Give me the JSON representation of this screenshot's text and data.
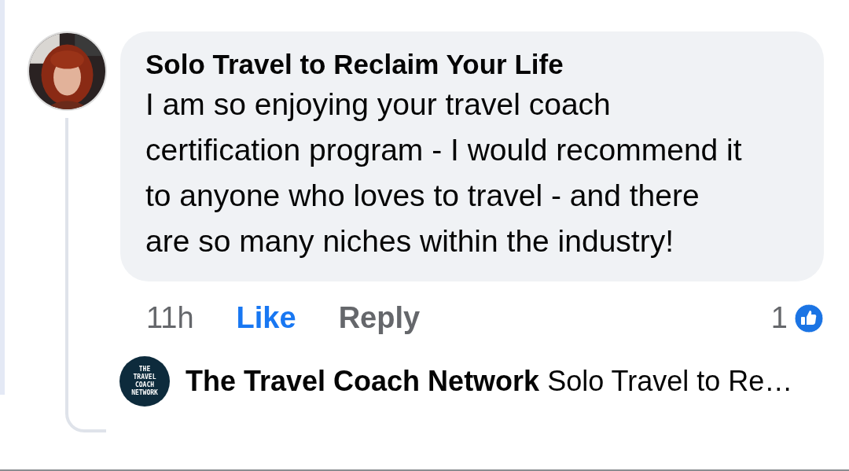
{
  "comment": {
    "author": "Solo Travel to Reclaim Your Life",
    "text": "I am so enjoying your travel coach certification program - I would recommend it to anyone who loves to travel - and there are so many niches within the industry!",
    "time": "11h",
    "actions": [
      {
        "label": "Like",
        "liked": true
      },
      {
        "label": "Reply",
        "liked": false
      }
    ],
    "reaction_count": "1"
  },
  "reply": {
    "logo_lines": [
      "THE",
      "TRAVEL",
      "COACH",
      "NETWORK"
    ],
    "author": "The Travel Coach Network",
    "preview": "Solo Travel to Re…"
  }
}
